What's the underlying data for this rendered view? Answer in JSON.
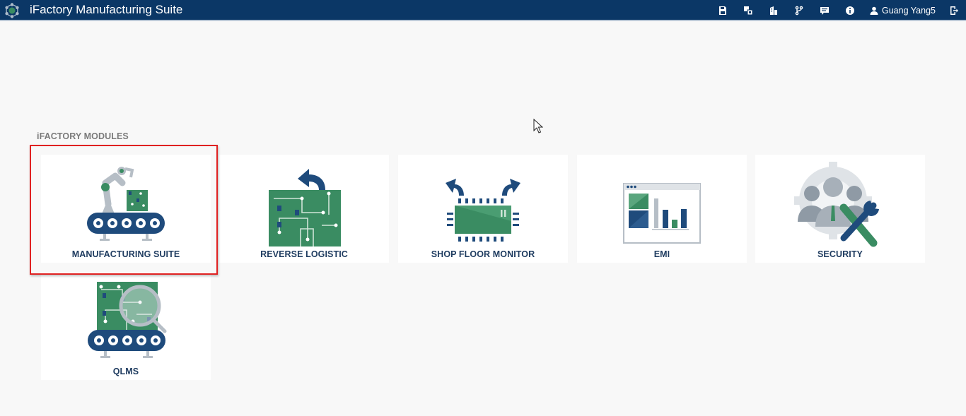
{
  "app": {
    "title": "iFactory Manufacturing Suite"
  },
  "toolbar": {
    "icons": [
      "save-icon",
      "translate-icon",
      "building-icon",
      "branch-icon",
      "message-icon",
      "info-icon",
      "logout-icon"
    ],
    "user_name": "Guang Yang5"
  },
  "section": {
    "title": "iFACTORY MODULES"
  },
  "modules": [
    {
      "label": "MANUFACTURING SUITE",
      "icon": "robot-arm-conveyor-icon",
      "selected": true
    },
    {
      "label": "REVERSE LOGISTIC",
      "icon": "circuit-board-return-icon",
      "selected": false
    },
    {
      "label": "SHOP FLOOR MONITOR",
      "icon": "chip-arrows-icon",
      "selected": false
    },
    {
      "label": "EMI",
      "icon": "dashboard-window-icon",
      "selected": false
    },
    {
      "label": "SECURITY",
      "icon": "users-gear-tools-icon",
      "selected": false
    },
    {
      "label": "QLMS",
      "icon": "board-magnifier-conveyor-icon",
      "selected": false
    }
  ],
  "colors": {
    "header": "#0b3766",
    "accent_green": "#3a8c62",
    "navy": "#1f4b7c",
    "selection": "#e02222"
  }
}
